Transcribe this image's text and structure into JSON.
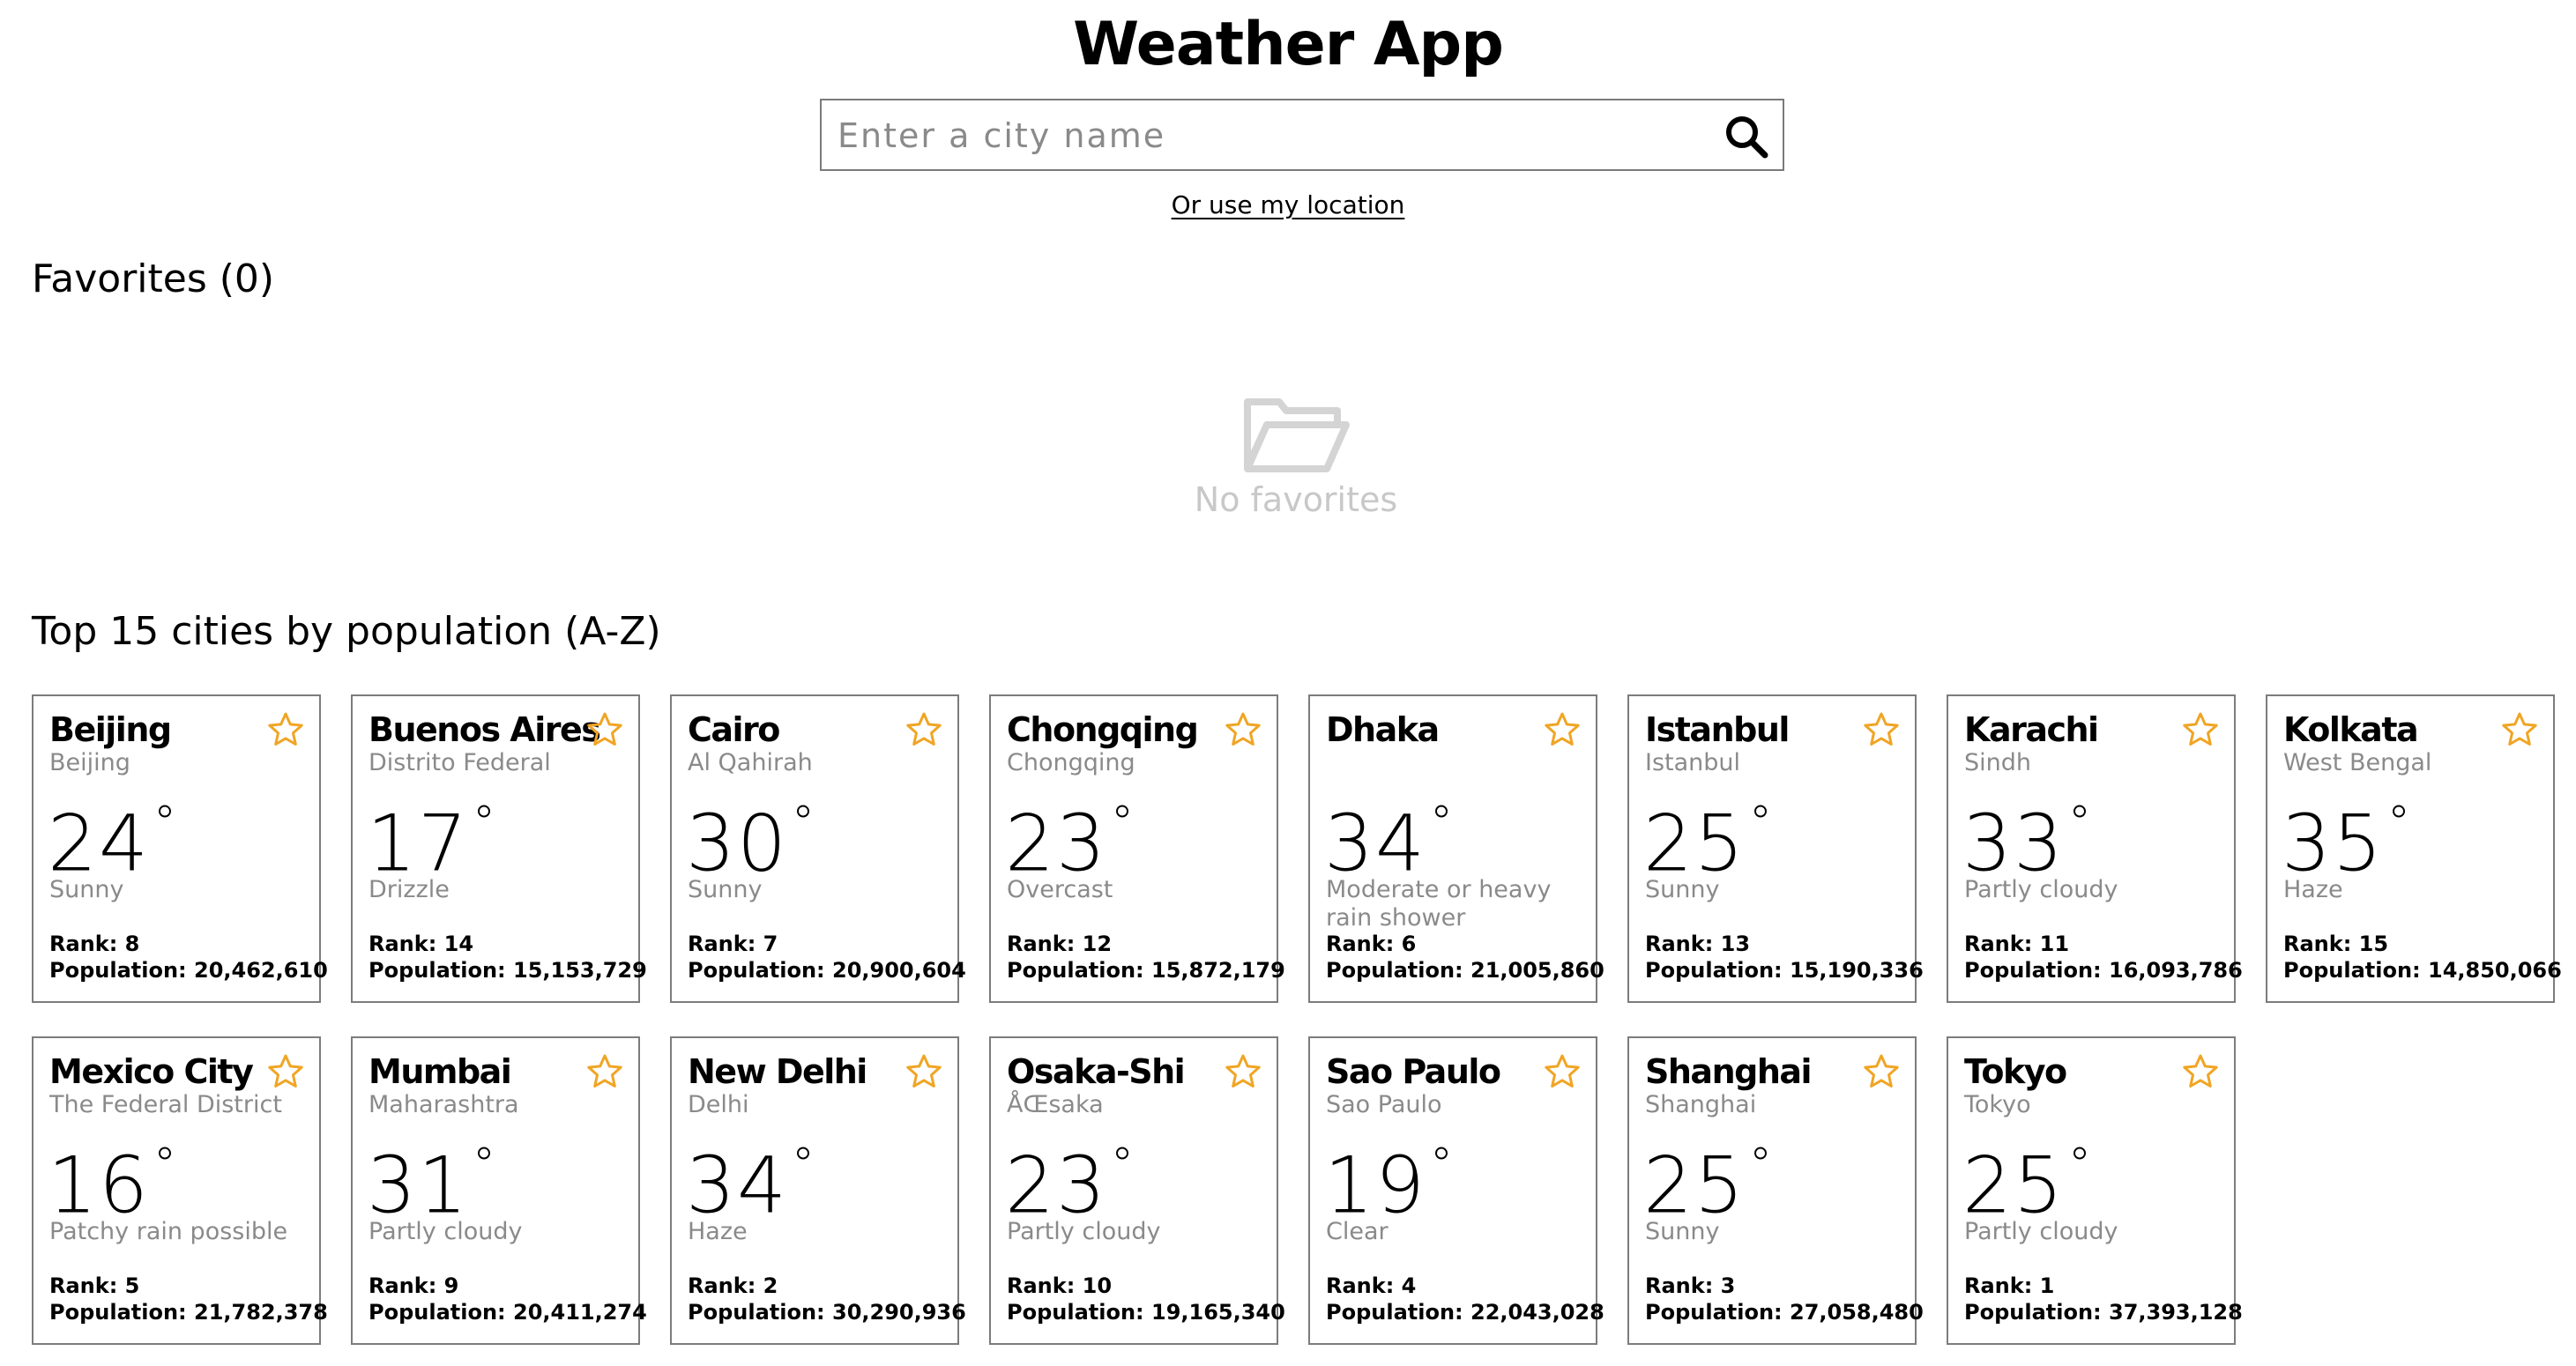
{
  "app": {
    "title": "Weather App"
  },
  "search": {
    "placeholder": "Enter a city name",
    "location_link": "Or use my location"
  },
  "favorites": {
    "heading": "Favorites (0)",
    "empty_text": "No favorites"
  },
  "top_cities": {
    "heading": "Top 15 cities by population (A-Z)",
    "rank_prefix": "Rank: ",
    "population_prefix": "Population: ",
    "cities": [
      {
        "city": "Beijing",
        "region": "Beijing",
        "temp": "24",
        "condition": "Sunny",
        "rank": "Rank: 8",
        "population": "Population: 20,462,610"
      },
      {
        "city": "Buenos Aires",
        "region": "Distrito Federal",
        "temp": "17",
        "condition": "Drizzle",
        "rank": "Rank: 14",
        "population": "Population: 15,153,729"
      },
      {
        "city": "Cairo",
        "region": "Al Qahirah",
        "temp": "30",
        "condition": "Sunny",
        "rank": "Rank: 7",
        "population": "Population: 20,900,604"
      },
      {
        "city": "Chongqing",
        "region": "Chongqing",
        "temp": "23",
        "condition": "Overcast",
        "rank": "Rank: 12",
        "population": "Population: 15,872,179"
      },
      {
        "city": "Dhaka",
        "region": "",
        "temp": "34",
        "condition": "Moderate or heavy rain shower",
        "rank": "Rank: 6",
        "population": "Population: 21,005,860"
      },
      {
        "city": "Istanbul",
        "region": "Istanbul",
        "temp": "25",
        "condition": "Sunny",
        "rank": "Rank: 13",
        "population": "Population: 15,190,336"
      },
      {
        "city": "Karachi",
        "region": "Sindh",
        "temp": "33",
        "condition": "Partly cloudy",
        "rank": "Rank: 11",
        "population": "Population: 16,093,786"
      },
      {
        "city": "Kolkata",
        "region": "West Bengal",
        "temp": "35",
        "condition": "Haze",
        "rank": "Rank: 15",
        "population": "Population: 14,850,066"
      },
      {
        "city": "Mexico City",
        "region": "The Federal District",
        "temp": "16",
        "condition": "Patchy rain possible",
        "rank": "Rank: 5",
        "population": "Population: 21,782,378"
      },
      {
        "city": "Mumbai",
        "region": "Maharashtra",
        "temp": "31",
        "condition": "Partly cloudy",
        "rank": "Rank: 9",
        "population": "Population: 20,411,274"
      },
      {
        "city": "New Delhi",
        "region": "Delhi",
        "temp": "34",
        "condition": "Haze",
        "rank": "Rank: 2",
        "population": "Population: 30,290,936"
      },
      {
        "city": "Osaka-Shi",
        "region": "ÅŒsaka",
        "temp": "23",
        "condition": "Partly cloudy",
        "rank": "Rank: 10",
        "population": "Population: 19,165,340"
      },
      {
        "city": "Sao Paulo",
        "region": "Sao Paulo",
        "temp": "19",
        "condition": "Clear",
        "rank": "Rank: 4",
        "population": "Population: 22,043,028"
      },
      {
        "city": "Shanghai",
        "region": "Shanghai",
        "temp": "25",
        "condition": "Sunny",
        "rank": "Rank: 3",
        "population": "Population: 27,058,480"
      },
      {
        "city": "Tokyo",
        "region": "Tokyo",
        "temp": "25",
        "condition": "Partly cloudy",
        "rank": "Rank: 1",
        "population": "Population: 37,393,128"
      }
    ]
  },
  "icons": {
    "search": "search-icon",
    "star": "star-outline-icon",
    "folder": "folder-open-icon"
  },
  "colors": {
    "star": "#f0a524",
    "muted_text": "#8a8a8a",
    "empty_state": "#c8c8c8",
    "card_border": "#7c7c7c"
  }
}
